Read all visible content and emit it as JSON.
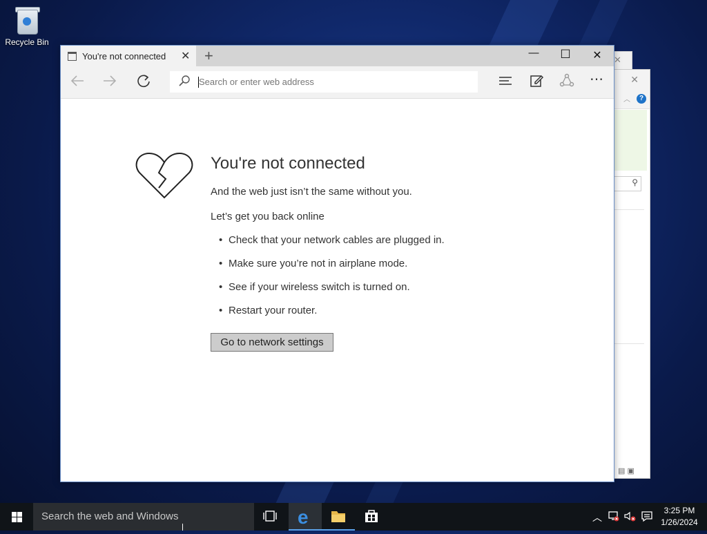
{
  "desktop": {
    "recycle_bin_label": "Recycle Bin"
  },
  "browser": {
    "tab_title": "You're not connected",
    "new_tab_symbol": "+",
    "address_placeholder": "Search or enter web address",
    "window_controls": {
      "minimize": "—",
      "maximize": "☐",
      "close": "✕"
    }
  },
  "error_page": {
    "heading": "You're not connected",
    "subheading": "And the web just isn’t the same without you.",
    "prompt": "Let’s get you back online",
    "tips": [
      "Check that your network cables are plugged in.",
      "Make sure you’re not in airplane mode.",
      "See if your wireless switch is turned on.",
      "Restart your router."
    ],
    "button_label": "Go to network settings"
  },
  "taskbar": {
    "search_placeholder": "Search the web and Windows",
    "clock_time": "3:25 PM",
    "clock_date": "1/26/2024",
    "accent_color": "#5aa0e8"
  },
  "icons": [
    "windows-start-icon",
    "task-view-icon",
    "edge-icon",
    "file-explorer-icon",
    "store-icon",
    "chevron-up-icon",
    "network-icon",
    "volume-muted-icon",
    "action-center-icon",
    "back-icon",
    "forward-icon",
    "refresh-icon",
    "hub-icon",
    "web-note-icon",
    "share-icon",
    "more-icon",
    "broken-heart-icon"
  ]
}
